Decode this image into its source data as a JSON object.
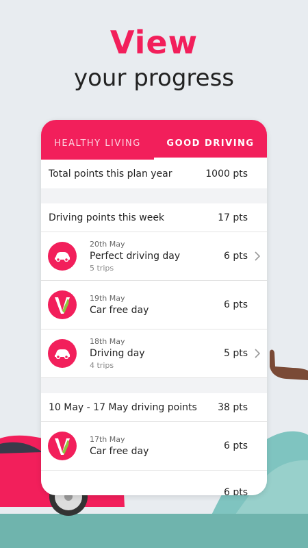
{
  "headline": {
    "line1": "View",
    "line2": "your progress"
  },
  "tabs": [
    {
      "label": "HEALTHY LIVING",
      "active": false
    },
    {
      "label": "GOOD DRIVING",
      "active": true
    }
  ],
  "total": {
    "label": "Total points this plan year",
    "value": "1000 pts"
  },
  "this_week": {
    "label": "Driving points this week",
    "value": "17 pts",
    "items": [
      {
        "icon": "car-icon",
        "date": "20th May",
        "title": "Perfect driving day",
        "sub": "5 trips",
        "pts": "6 pts",
        "chevron": true
      },
      {
        "icon": "vitality-v-icon",
        "date": "19th May",
        "title": "Car free day",
        "sub": "",
        "pts": "6 pts",
        "chevron": false
      },
      {
        "icon": "car-icon",
        "date": "18th May",
        "title": "Driving day",
        "sub": "4 trips",
        "pts": "5 pts",
        "chevron": true
      }
    ]
  },
  "last_week": {
    "label": "10 May - 17 May driving points",
    "value": "38 pts",
    "items": [
      {
        "icon": "vitality-v-icon",
        "date": "17th May",
        "title": "Car free day",
        "sub": "",
        "pts": "6 pts",
        "chevron": false
      },
      {
        "icon": "",
        "date": "",
        "title": "",
        "sub": "",
        "pts": "6 pts",
        "chevron": false
      }
    ]
  },
  "colors": {
    "accent": "#f21f5b",
    "background": "#e8ecf0",
    "hill": "#7fc4c0",
    "ground": "#5fa7a0",
    "vitality_green": "#8cc63e"
  }
}
